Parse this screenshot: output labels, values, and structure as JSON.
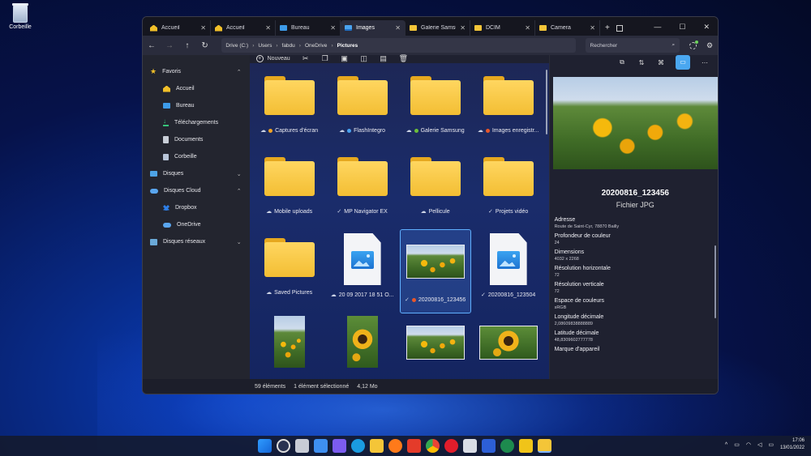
{
  "desktop": {
    "recycle_label": "Corbeille"
  },
  "tabs": [
    {
      "label": "Accueil",
      "icon": "home-icon"
    },
    {
      "label": "Accueil",
      "icon": "home-icon"
    },
    {
      "label": "Bureau",
      "icon": "desktop-icon"
    },
    {
      "label": "Images",
      "icon": "images-icon",
      "active": true
    },
    {
      "label": "Galerie Samsu",
      "icon": "folder-icon"
    },
    {
      "label": "DCIM",
      "icon": "folder-icon"
    },
    {
      "label": "Camera",
      "icon": "folder-icon"
    }
  ],
  "breadcrumb": [
    "Drive (C:)",
    "Users",
    "fabdu",
    "OneDrive",
    "Pictures"
  ],
  "search_placeholder": "Rechercher",
  "toolbar": {
    "new_label": "Nouveau"
  },
  "sidebar": [
    {
      "label": "Favoris",
      "icon": "star-icon",
      "level": 0,
      "chevron": "^"
    },
    {
      "label": "Accueil",
      "icon": "home-icon",
      "level": 1
    },
    {
      "label": "Bureau",
      "icon": "desktop-icon",
      "level": 1
    },
    {
      "label": "Téléchargements",
      "icon": "download-icon",
      "level": 1
    },
    {
      "label": "Documents",
      "icon": "documents-icon",
      "level": 1
    },
    {
      "label": "Corbeille",
      "icon": "recycle-bin-icon",
      "level": 1
    },
    {
      "label": "Disques",
      "icon": "drive-icon",
      "level": 0,
      "chevron": "v"
    },
    {
      "label": "Disques Cloud",
      "icon": "cloud-drive-icon",
      "level": 0,
      "chevron": "^"
    },
    {
      "label": "Dropbox",
      "icon": "dropbox-icon",
      "level": 1
    },
    {
      "label": "OneDrive",
      "icon": "onedrive-icon",
      "level": 1
    },
    {
      "label": "Disques réseaux",
      "icon": "network-drive-icon",
      "level": 0,
      "chevron": "v"
    }
  ],
  "items": [
    {
      "name": "Captures d'écran",
      "kind": "folder",
      "sync": "cloud",
      "dot": "#f2a324"
    },
    {
      "name": "FlashIntegro",
      "kind": "folder",
      "sync": "cloud",
      "dot": "#4aa3f0"
    },
    {
      "name": "Galerie Samsung",
      "kind": "folder",
      "sync": "cloud",
      "dot": "#6cbf3a"
    },
    {
      "name": "Images enregistr...",
      "kind": "folder",
      "sync": "cloud",
      "dot": "#e8572a"
    },
    {
      "name": "Mobile uploads",
      "kind": "folder",
      "sync": "cloud"
    },
    {
      "name": "MP Navigator EX",
      "kind": "folder",
      "sync": "check"
    },
    {
      "name": "Pellicule",
      "kind": "folder",
      "sync": "cloud"
    },
    {
      "name": "Projets vidéo",
      "kind": "folder",
      "sync": "check"
    },
    {
      "name": "Saved Pictures",
      "kind": "folder",
      "sync": "cloud"
    },
    {
      "name": "20 09 2017 18 51 O...",
      "kind": "image-file",
      "sync": "cloud"
    },
    {
      "name": "20200816_123456",
      "kind": "photo",
      "sync": "check",
      "dot": "#e8572a",
      "selected": true
    },
    {
      "name": "20200816_123504",
      "kind": "image-file",
      "sync": "check"
    },
    {
      "name": "",
      "kind": "photo-portrait"
    },
    {
      "name": "",
      "kind": "photo-portrait-closeup"
    },
    {
      "name": "",
      "kind": "photo"
    },
    {
      "name": "",
      "kind": "photo-closeup"
    }
  ],
  "details": {
    "title": "20200816_123456",
    "subtitle": "Fichier JPG",
    "properties": [
      {
        "key": "Adresse",
        "value": "Route de Saint-Cyr, 78870 Bailly"
      },
      {
        "key": "Profondeur de couleur",
        "value": "24"
      },
      {
        "key": "Dimensions",
        "value": "4032 x 2268"
      },
      {
        "key": "Résolution horizontale",
        "value": "72"
      },
      {
        "key": "Résolution verticale",
        "value": "72"
      },
      {
        "key": "Espace de couleurs",
        "value": "sRGB"
      },
      {
        "key": "Longitude décimale",
        "value": "2,08609838888889"
      },
      {
        "key": "Latitude décimale",
        "value": "48,8309602777778"
      },
      {
        "key": "Marque d'appareil",
        "value": ""
      }
    ]
  },
  "status": {
    "count": "59 éléments",
    "selected": "1 élément sélectionné",
    "size": "4,12 Mo"
  },
  "clock": {
    "time": "17:06",
    "date": "13/01/2022"
  }
}
